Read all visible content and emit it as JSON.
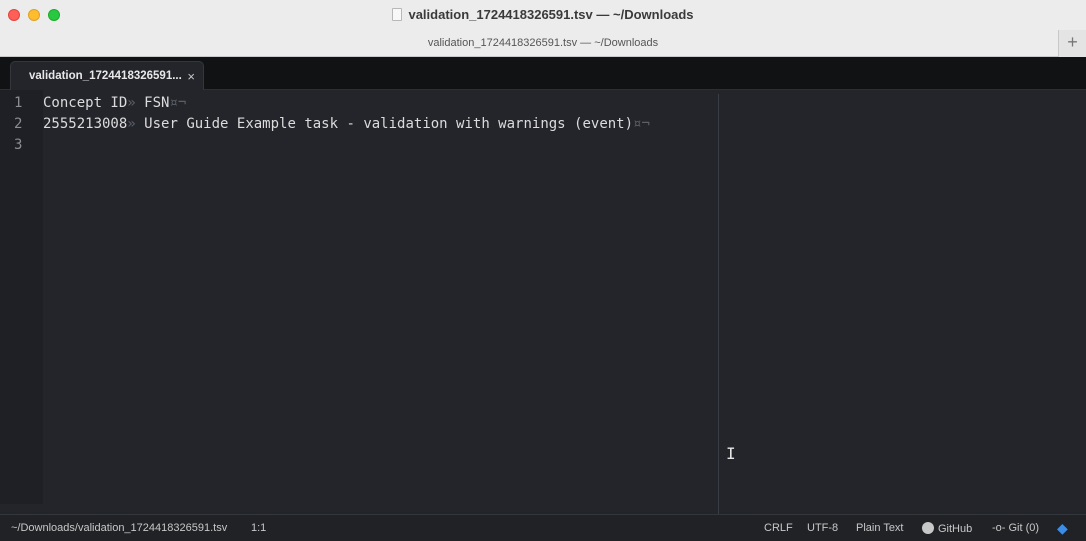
{
  "window": {
    "title": "validation_1724418326591.tsv — ~/Downloads",
    "subtitle": "validation_1724418326591.tsv — ~/Downloads",
    "new_tab_label": "+"
  },
  "tab": {
    "label": "validation_1724418326591...",
    "close_label": "×"
  },
  "editor": {
    "line_numbers": [
      "1",
      "2",
      "3"
    ],
    "lines": [
      {
        "col1": "Concept ID",
        "tab_marker": "»",
        "col2": "FSN",
        "eol_marker": "¤¬"
      },
      {
        "col1": "2555213008",
        "tab_marker": "»",
        "col2": "User Guide Example task - validation with warnings (event)",
        "eol_marker": "¤¬"
      },
      {
        "col1": "",
        "tab_marker": "",
        "col2": "",
        "eol_marker": ""
      }
    ]
  },
  "statusbar": {
    "file_path": "~/Downloads/validation_1724418326591.tsv",
    "cursor_position": "1:1",
    "line_ending": "CRLF",
    "encoding": "UTF-8",
    "grammar": "Plain Text",
    "github_label": "GitHub",
    "git_label": "Git (0)"
  },
  "icons": {
    "document": "document-icon",
    "github": "github-icon",
    "git_commit": "git-commit-icon",
    "feedback": "feedback-bird-icon"
  },
  "colors": {
    "editor_bg": "#23252b",
    "gutter_bg": "#1f2025",
    "text": "#dcdcdc",
    "invisible_char": "#5b5f66",
    "accent": "#3d8ce6"
  }
}
